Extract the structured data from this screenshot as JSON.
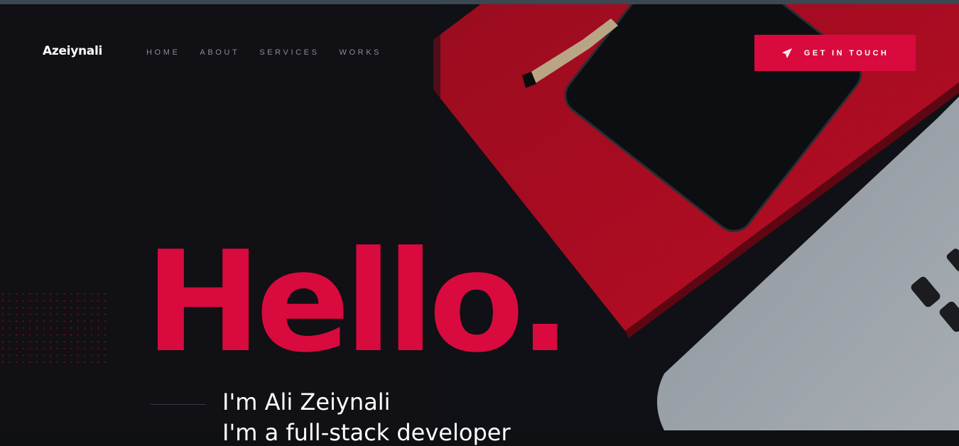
{
  "brand": {
    "logo_text": "Azeiynali"
  },
  "nav": {
    "items": [
      {
        "label": "HOME"
      },
      {
        "label": "ABOUT"
      },
      {
        "label": "SERVICES"
      },
      {
        "label": "WORKS"
      }
    ]
  },
  "cta": {
    "label": "GET IN TOUCH",
    "icon": "paper-plane-icon"
  },
  "hero": {
    "headline": "Hello.",
    "intro": "I'm Ali Zeiynali",
    "intro_line2": "I'm a full-stack developer"
  },
  "colors": {
    "accent": "#d80a3e",
    "background": "#101116",
    "nav_text": "#8a8d94"
  }
}
